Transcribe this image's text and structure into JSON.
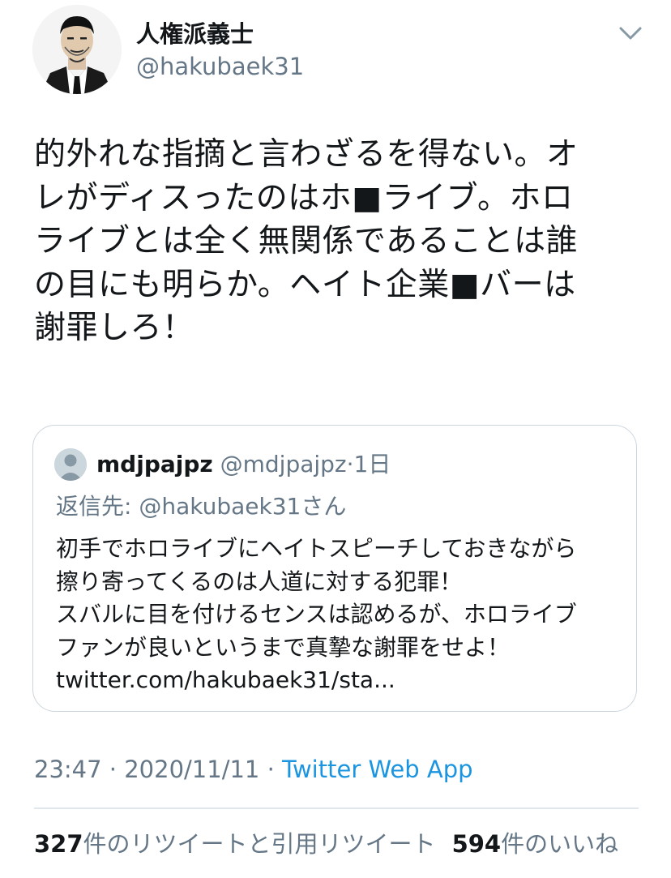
{
  "author": {
    "display_name": "人権派義士",
    "handle": "@hakubaek31"
  },
  "icons": {
    "avatar": "avatar-illustration",
    "menu": "chevron-down-icon",
    "quoted_avatar": "default-avatar-icon"
  },
  "tweet": {
    "lines": [
      "的外れな指摘と言わざるを得ない。オ",
      "レがディスったのはホ■ライブ。ホロ",
      "ライブとは全く無関係であることは誰",
      "の目にも明らか。ヘイト企業■バーは",
      "謝罪しろ！"
    ]
  },
  "quoted": {
    "name": "mdjpajpz",
    "handle": "@mdjpajpz",
    "separator": "·",
    "time": "1日",
    "reply_to": "返信先: @hakubaek31さん",
    "lines": [
      "初手でホロライブにヘイトスピーチしておきながら",
      "擦り寄ってくるのは人道に対する犯罪！",
      "スバルに目を付けるセンスは認めるが、ホロライブ",
      "ファンが良いというまで真摯な謝罪をせよ！",
      "twitter.com/hakubaek31/sta..."
    ]
  },
  "meta": {
    "time": "23:47",
    "separator1": " · ",
    "date": "2020/11/11",
    "separator2": " · ",
    "source": "Twitter Web App"
  },
  "stats": {
    "retweets_count": "327",
    "retweets_label": "件のリツイートと引用リツイート",
    "likes_count": "594",
    "likes_label": "件のいいね"
  },
  "colors": {
    "text": "#14171a",
    "secondary": "#657786",
    "link": "#1b95e0",
    "border": "#ccd6dd"
  }
}
